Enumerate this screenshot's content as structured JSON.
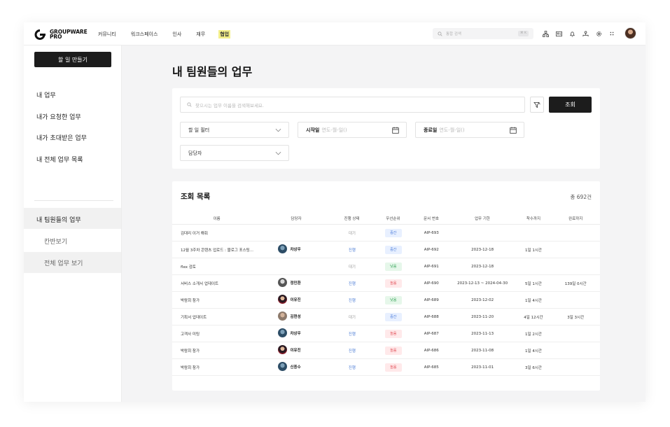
{
  "header": {
    "logo_line1": "GROUPWARE",
    "logo_line2": "PRO",
    "nav": [
      {
        "label": "커뮤니티",
        "active": false
      },
      {
        "label": "워크스페이스",
        "active": false
      },
      {
        "label": "인사",
        "active": false
      },
      {
        "label": "재무",
        "active": false
      },
      {
        "label": "협업",
        "active": true
      }
    ],
    "search_placeholder": "통합 검색",
    "search_shortcut": "⌘ K",
    "icons": [
      "org-chart-icon",
      "contacts-icon",
      "notification-icon",
      "team-icon",
      "settings-icon",
      "apps-grid-icon"
    ]
  },
  "sidebar": {
    "new_task_label": "할 일 만들기",
    "items": [
      {
        "label": "내 업무"
      },
      {
        "label": "내가 요청한 업무"
      },
      {
        "label": "내가 초대받은 업무"
      },
      {
        "label": "내 전체 업무 목록"
      }
    ],
    "team_section": {
      "label": "내 팀원들의 업무",
      "sub_items": [
        {
          "label": "칸반보기"
        },
        {
          "label": "전체 업무 보기",
          "selected": true
        }
      ]
    }
  },
  "main": {
    "title": "내 팀원들의 업무",
    "filters": {
      "keyword_placeholder": "찾으시는 업무 이름을 검색해보세요.",
      "query_button": "조회",
      "task_filter_label": "할 일 필터",
      "start_date_label": "시작일",
      "start_date_placeholder": "연도-월-일()",
      "end_date_label": "종료일",
      "end_date_placeholder": "연도-월-일()",
      "assignee_label": "담당자"
    },
    "list": {
      "title": "조회 목록",
      "total": "총 692건",
      "columns": [
        "이름",
        "담당자",
        "진행 상태",
        "우선순위",
        "문서 번호",
        "업무 기한",
        "착수까지",
        "완료까지"
      ],
      "rows": [
        {
          "name": "김대리 이거 해줘",
          "assignee": "",
          "avatar": "",
          "status": "대기",
          "status_type": "wait",
          "priority": "중간",
          "priority_type": "mid",
          "doc": "AIP-693",
          "period": "",
          "start": "",
          "end": ""
        },
        {
          "name": "12월 3주차 콘텐츠 업로드 : 블로그 포스팅...",
          "assignee": "차상우",
          "avatar": "av-a",
          "status": "진행",
          "status_type": "prog",
          "priority": "중간",
          "priority_type": "mid",
          "doc": "AIP-692",
          "period": "2023-12-18",
          "start": "1일 1시간",
          "end": ""
        },
        {
          "name": "flex 검토",
          "assignee": "",
          "avatar": "",
          "status": "대기",
          "status_type": "wait",
          "priority": "낮음",
          "priority_type": "low",
          "doc": "AIP-691",
          "period": "2023-12-18",
          "start": "",
          "end": ""
        },
        {
          "name": "서비스 소개서 업데이트",
          "assignee": "정민환",
          "avatar": "av-b",
          "status": "진행",
          "status_type": "prog",
          "priority": "높음",
          "priority_type": "high",
          "doc": "AIP-690",
          "period": "2023-12-13 ~ 2024-04-30",
          "start": "5일 1시간",
          "end": "139일 0시간"
        },
        {
          "name": "박람회 참가",
          "assignee": "이유진",
          "avatar": "av-c",
          "status": "진행",
          "status_type": "prog",
          "priority": "낮음",
          "priority_type": "low",
          "doc": "AIP-689",
          "period": "2023-12-02",
          "start": "1일 4시간",
          "end": ""
        },
        {
          "name": "기획서 업데이트",
          "assignee": "김현성",
          "avatar": "av-d",
          "status": "대기",
          "status_type": "wait",
          "priority": "중간",
          "priority_type": "mid",
          "doc": "AIP-688",
          "period": "2023-11-20",
          "start": "4일 12시간",
          "end": "3일 3시간"
        },
        {
          "name": "고객사 미팅",
          "assignee": "차상우",
          "avatar": "av-a",
          "status": "진행",
          "status_type": "prog",
          "priority": "높음",
          "priority_type": "high",
          "doc": "AIP-687",
          "period": "2023-11-13",
          "start": "1일 2시간",
          "end": ""
        },
        {
          "name": "박람회 참가",
          "assignee": "이유진",
          "avatar": "av-c",
          "status": "진행",
          "status_type": "prog",
          "priority": "높음",
          "priority_type": "high",
          "doc": "AIP-686",
          "period": "2023-11-08",
          "start": "1일 4시간",
          "end": ""
        },
        {
          "name": "박람회 참가",
          "assignee": "신종수",
          "avatar": "av-a",
          "status": "진행",
          "status_type": "prog",
          "priority": "높음",
          "priority_type": "high",
          "doc": "AIP-685",
          "period": "2023-11-01",
          "start": "3일 6시간",
          "end": ""
        }
      ]
    }
  },
  "colors": {
    "accent_dark": "#1c1c1c",
    "nav_highlight": "#f3ef8a",
    "status_progress": "#4f7fd6",
    "status_wait": "#9a9a9a",
    "priority_mid_bg": "#e8f0ff",
    "priority_mid_fg": "#3f73d8",
    "priority_low_bg": "#e6f7ea",
    "priority_low_fg": "#2fa154",
    "priority_high_bg": "#ffe9ea",
    "priority_high_fg": "#e0454f"
  }
}
